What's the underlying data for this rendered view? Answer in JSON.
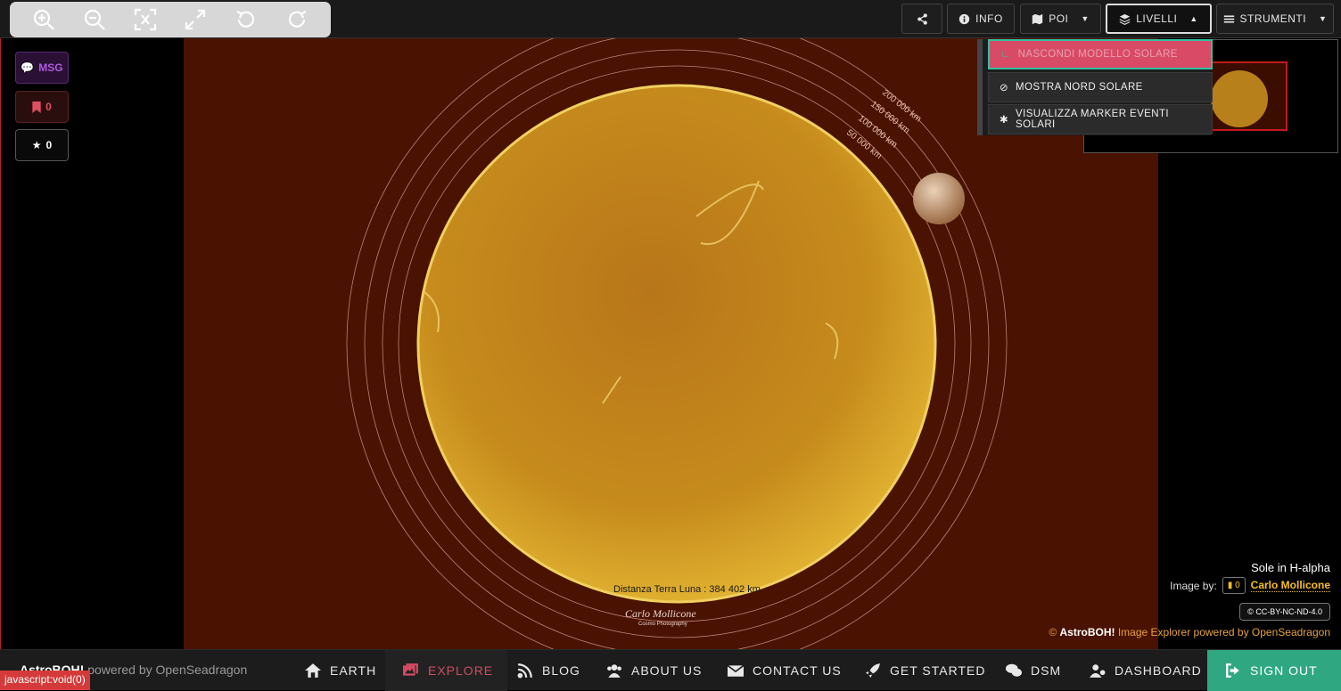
{
  "toolbar": {
    "zoom_buttons": [
      "zoom-in",
      "zoom-out",
      "reset-view",
      "fullscreen",
      "rotate-left",
      "rotate-right"
    ],
    "share_label": "",
    "info_label": "INFO",
    "poi_label": "POI",
    "livelli_label": "LIVELLI",
    "strumenti_label": "STRUMENTI"
  },
  "left": {
    "msg_label": "MSG",
    "bookmark_count": "0",
    "star_count": "0"
  },
  "dropdown": {
    "items": [
      "NASCONDI MODELLO SOLARE",
      "MOSTRA NORD SOLARE",
      "VISUALIZZA MARKER EVENTI SOLARI"
    ]
  },
  "viewer": {
    "scale_labels": [
      "200 000 km",
      "150 000 km",
      "100 000 km",
      "50 000 km"
    ],
    "distance_label": "Distanza Terra Luna : 384 402 km",
    "signature": "Carlo Mollicone",
    "signature_sub": "Cosmo Photography"
  },
  "info": {
    "title": "Sole in H-alpha",
    "image_by": "Image by:",
    "badge_count": "0",
    "author": "Carlo Mollicone",
    "license": "CC-BY-NC-ND-4.0",
    "credit_brand": "AstroBOH!",
    "credit_text": "Image Explorer powered by OpenSeadragon"
  },
  "bottom": {
    "brand": "AstroBOH!",
    "powered": "powered by OpenSeadragon",
    "nav": [
      "EARTH",
      "EXPLORE",
      "BLOG",
      "ABOUT US",
      "CONTACT US",
      "GET STARTED",
      "DSM",
      "DASHBOARD",
      "SIGN OUT"
    ],
    "status": "javascript:void(0)"
  },
  "colors": {
    "accent": "#d94a66",
    "teal": "#2fa882",
    "sun": "#c8901a"
  }
}
